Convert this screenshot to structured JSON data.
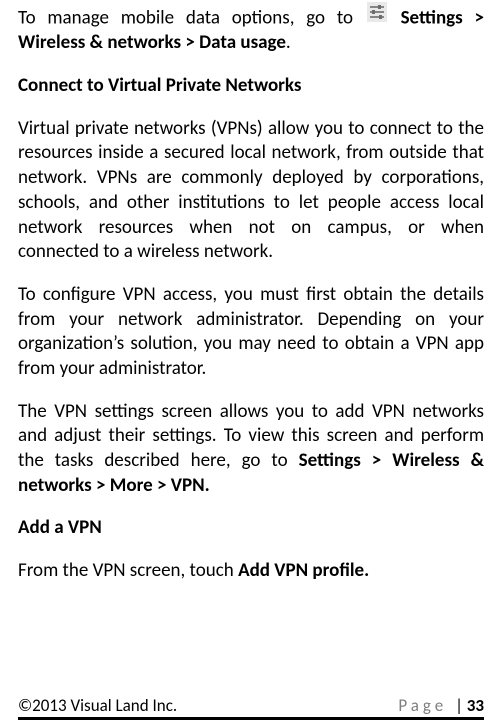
{
  "para_manage_pre": "To manage mobile data options, go to ",
  "para_manage_post": "Settings > Wireless & networks > Data usage",
  "para_manage_end": ".",
  "heading_vpn": "Connect to Virtual Private Networks",
  "para_vpn_intro": "Virtual private networks (VPNs) allow you to connect to the resources inside a secured local network, from outside that network. VPNs are commonly deployed by corporations, schools, and other institutions to let people access local network resources when not on campus, or when connected to a wireless network.",
  "para_vpn_config": "To configure VPN access, you must first obtain the details from your network administrator. Depending on your organization’s solution, you may need to obtain a VPN app from your administrator.",
  "para_vpn_settings_pre": "The VPN settings screen allows you to add VPN networks and adjust their settings. To view this screen and perform the tasks described here, go to ",
  "para_vpn_settings_bold": "Settings > Wireless & networks > More > VPN.",
  "heading_add": "Add a VPN",
  "para_add_pre": "From the VPN screen, touch ",
  "para_add_bold": "Add VPN profile.",
  "footer_copyright": "©2013 Visual Land Inc.",
  "footer_page_label": "Page",
  "footer_page_num": "33"
}
